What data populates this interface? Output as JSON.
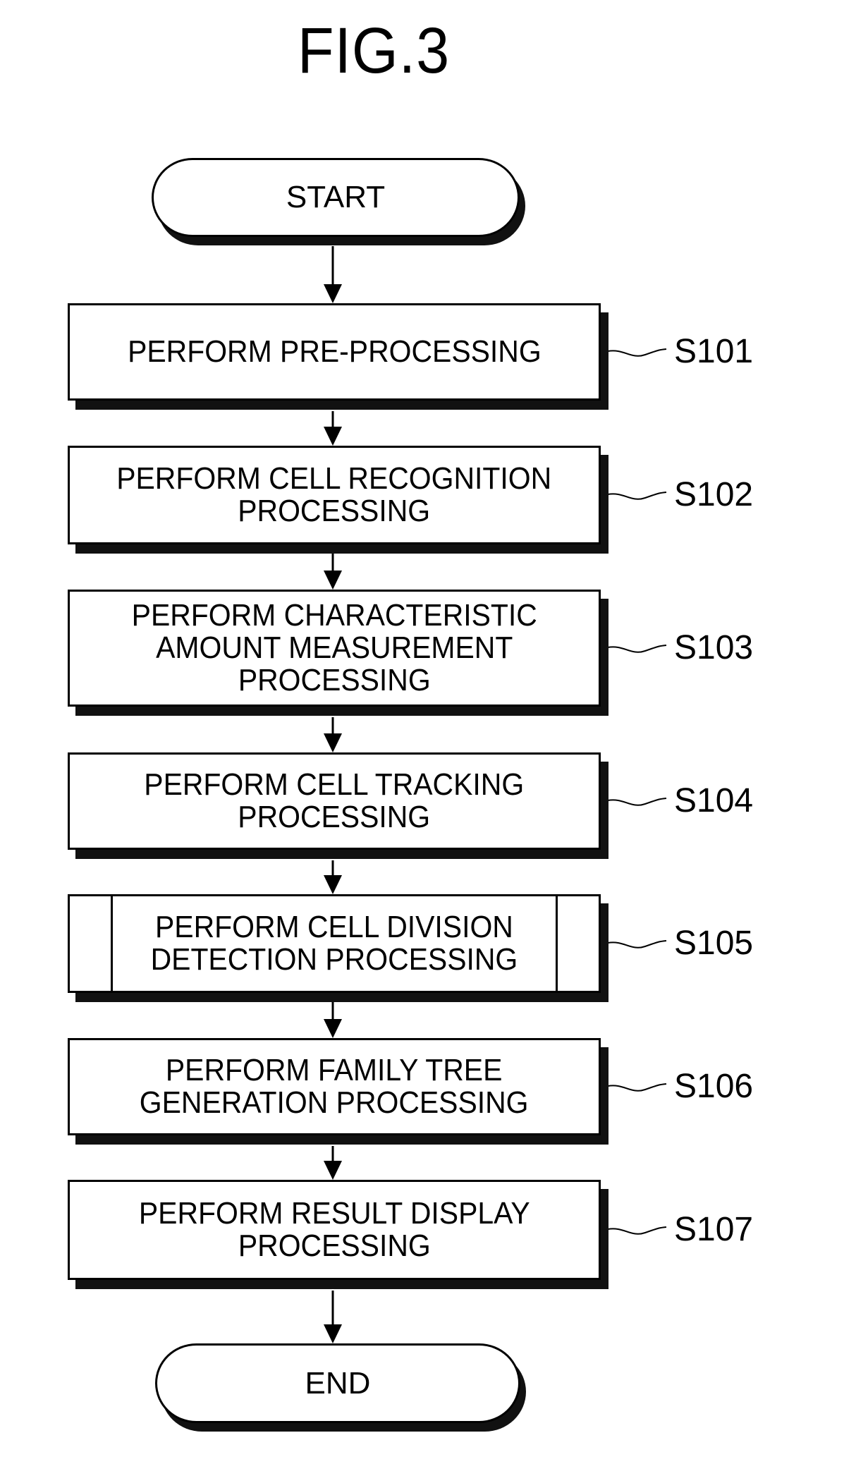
{
  "figure": {
    "title": "FIG.3"
  },
  "flowchart": {
    "start_label": "START",
    "end_label": "END",
    "steps": [
      {
        "id": "S101",
        "text": "PERFORM PRE-PROCESSING",
        "type": "process"
      },
      {
        "id": "S102",
        "text": "PERFORM CELL RECOGNITION\nPROCESSING",
        "type": "process"
      },
      {
        "id": "S103",
        "text": "PERFORM CHARACTERISTIC\nAMOUNT MEASUREMENT\nPROCESSING",
        "type": "process"
      },
      {
        "id": "S104",
        "text": "PERFORM CELL TRACKING\nPROCESSING",
        "type": "process"
      },
      {
        "id": "S105",
        "text": "PERFORM CELL DIVISION\nDETECTION PROCESSING",
        "type": "subroutine"
      },
      {
        "id": "S106",
        "text": "PERFORM FAMILY TREE\nGENERATION PROCESSING",
        "type": "process"
      },
      {
        "id": "S107",
        "text": "PERFORM RESULT DISPLAY\nPROCESSING",
        "type": "process"
      }
    ]
  }
}
